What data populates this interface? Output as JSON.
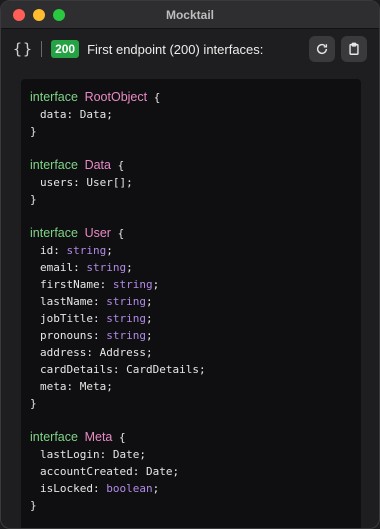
{
  "window": {
    "title": "Mocktail"
  },
  "toolbar": {
    "braces_glyph": "{}",
    "status_code": "200",
    "title": "First endpoint (200) interfaces:",
    "refresh_icon": "refresh-icon",
    "copy_icon": "clipboard-icon"
  },
  "code": {
    "interfaces": [
      {
        "keyword": "interface",
        "name": "RootObject",
        "fields": [
          {
            "name": "data",
            "type": "Data",
            "primitive": false
          }
        ]
      },
      {
        "keyword": "interface",
        "name": "Data",
        "fields": [
          {
            "name": "users",
            "type": "User[]",
            "primitive": false
          }
        ]
      },
      {
        "keyword": "interface",
        "name": "User",
        "fields": [
          {
            "name": "id",
            "type": "string",
            "primitive": true
          },
          {
            "name": "email",
            "type": "string",
            "primitive": true
          },
          {
            "name": "firstName",
            "type": "string",
            "primitive": true
          },
          {
            "name": "lastName",
            "type": "string",
            "primitive": true
          },
          {
            "name": "jobTitle",
            "type": "string",
            "primitive": true
          },
          {
            "name": "pronouns",
            "type": "string",
            "primitive": true
          },
          {
            "name": "address",
            "type": "Address",
            "primitive": false
          },
          {
            "name": "cardDetails",
            "type": "CardDetails",
            "primitive": false
          },
          {
            "name": "meta",
            "type": "Meta",
            "primitive": false
          }
        ]
      },
      {
        "keyword": "interface",
        "name": "Meta",
        "fields": [
          {
            "name": "lastLogin",
            "type": "Date",
            "primitive": false
          },
          {
            "name": "accountCreated",
            "type": "Date",
            "primitive": false
          },
          {
            "name": "isLocked",
            "type": "boolean",
            "primitive": true
          }
        ]
      }
    ]
  },
  "colors": {
    "keyword": "#7fd387",
    "type_name": "#e88bc4",
    "primitive": "#b08ae6",
    "status_badge": "#25a244"
  }
}
